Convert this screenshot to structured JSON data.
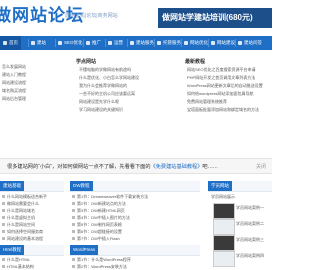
{
  "header": {
    "logo_text": "做网站论坛",
    "slogan": "建站主机|论坛|商务网站",
    "banner_text": "做网站学建站培训(680元)"
  },
  "nav": {
    "items": [
      {
        "label": "首页"
      },
      {
        "label": "建站"
      },
      {
        "label": "SEO优化"
      },
      {
        "label": "推广"
      },
      {
        "label": "运营"
      },
      {
        "label": "建站服务"
      },
      {
        "label": "托管服务"
      },
      {
        "label": "网站优化"
      },
      {
        "label": "网站建设"
      },
      {
        "label": "建站问答"
      }
    ]
  },
  "columns": {
    "mid": {
      "title": "学点网站",
      "links": [
        "不懂电脑的学做网站有前途吗",
        "什么是优化、小白怎么学网站建设",
        "我为什么会推荐学做网站的",
        "一些不好的主机公司应该要远离",
        "网站建设是先学什么呢",
        "学习网站建设的关键知识"
      ]
    },
    "right": {
      "title": "最新教程",
      "links": [
        "网站SEO优化之百度搜索资源平台申请",
        "PHP网站开发之首页调用文章列表方法",
        "WordPress网站更新文章后的自动推送设置",
        "如何给wordpress网站添加面包屑导航",
        "免费网站管理系统推荐",
        "宝塔面板批量添加网站和绑定域名的方法"
      ]
    },
    "left": {
      "links": [
        "怎么发展网站",
        "建站入门教程",
        "网站建设流程",
        "域名购买流程",
        "网站后台管理"
      ]
    }
  },
  "notice": {
    "prefix": "很多建站网的“小白”，对如何做网站一点不了解，先看看下面的",
    "link": "《免费建站基础教程》",
    "suffix": "吧……",
    "close": "关闭"
  },
  "panels": {
    "left": {
      "tag": "建站基础",
      "rows": [
        "什么网站模板适合新手",
        "做网站需要会什么",
        "什么是网站域名",
        "什么是虚拟主机",
        "什么是网站空间",
        "如何选择空间服务商",
        "网站建设的基本流程",
        "PHP网站什么程序最好用"
      ]
    },
    "mid": {
      "tag": "DW教程",
      "rows": [
        "第1节：Dreamweaver软件下载安装方法",
        "第2节：DW新建站点的方法",
        "第3节：DW新建HTML网页",
        "第4节：DW中插入图片的方法",
        "第5节：DW制作网页表格",
        "第6节：DW超链接的设置",
        "第7节：DW中插入Flash",
        "第8节：DW制作网页导航栏"
      ]
    },
    "right": {
      "tag": "学员网站",
      "rows": [
        "学员网站展示"
      ],
      "thumbs": [
        "学员网站案例一",
        "学员网站案例二",
        "学员网站案例三",
        "学员网站案例四",
        "学员网站案例五"
      ]
    },
    "bottom_left": {
      "tag": "Html教程",
      "rows": [
        "什么是HTML",
        "HTML基本结构",
        "HTML常用标签"
      ]
    },
    "bottom_mid": {
      "tag": "WordPress",
      "rows": [
        "第1节：什么是WordPress程序",
        "第2节：WordPress安装方法",
        "第3节：WordPress后台设置"
      ]
    }
  }
}
